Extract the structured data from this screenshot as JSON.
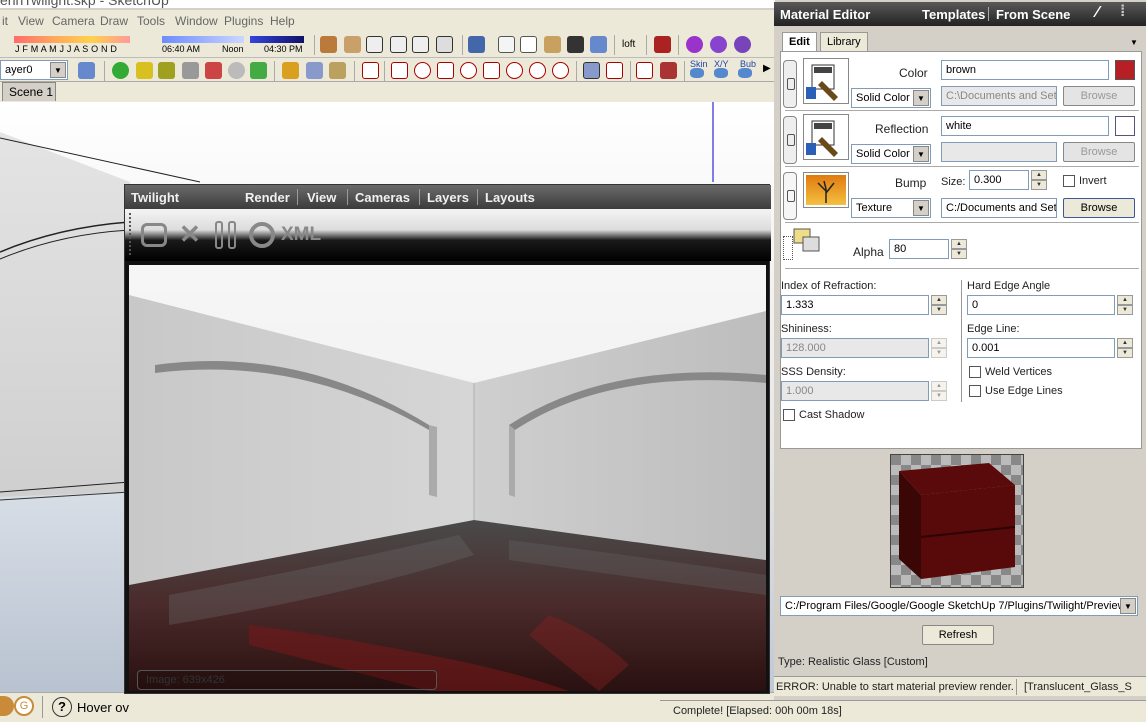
{
  "sketchup": {
    "title": "erinTwilight.skp - SketchUp",
    "menu": [
      "it",
      "View",
      "Camera",
      "Draw",
      "Tools",
      "Window",
      "Plugins",
      "Help"
    ],
    "months": "J F M A M J J A S O N D",
    "time_morning": "06:40 AM",
    "time_noon": "Noon",
    "time_evening": "04:30 PM",
    "loft_label": "loft",
    "layer_select": "ayer0",
    "toolbar_labels": {
      "skin": "Skin",
      "xy": "X/Y",
      "bub": "Bub"
    },
    "scene_tab": "Scene 1",
    "status_hover": "Hover ov",
    "complete_text": "Complete!  [Elapsed: 00h 00m 18s]"
  },
  "twilight": {
    "title": "Twilight",
    "menu": [
      "Render",
      "View",
      "Cameras",
      "Layers",
      "Layouts"
    ],
    "xml_label": "XML",
    "image_size": "Image: 639x426"
  },
  "material_editor": {
    "title": "Material Editor",
    "templates": "Templates",
    "from_scene": "From Scene",
    "tabs": [
      "Edit",
      "Library"
    ],
    "color": {
      "label": "Color",
      "type": "Solid Color",
      "value": "brown",
      "path": "C:\\Documents and Sett",
      "browse": "Browse",
      "swatch": "#b81f24"
    },
    "reflection": {
      "label": "Reflection",
      "type": "Solid Color",
      "value": "white",
      "path": "",
      "browse": "Browse",
      "swatch": "#ffffff"
    },
    "bump": {
      "label": "Bump",
      "type": "Texture",
      "size_label": "Size:",
      "size": "0.300",
      "invert": "Invert",
      "path": "C:/Documents and Sett",
      "browse": "Browse"
    },
    "alpha": {
      "label": "Alpha",
      "value": "80"
    },
    "ior": {
      "label": "Index of Refraction:",
      "value": "1.333"
    },
    "shininess": {
      "label": "Shininess:",
      "value": "128.000"
    },
    "sss": {
      "label": "SSS Density:",
      "value": "1.000"
    },
    "cast_shadow": "Cast Shadow",
    "hard_edge": {
      "label": "Hard Edge Angle",
      "value": "0"
    },
    "edge_line": {
      "label": "Edge Line:",
      "value": "0.001"
    },
    "weld_vertices": "Weld Vertices",
    "use_edge_lines": "Use Edge Lines",
    "preview_path": "C:/Program Files/Google/Google SketchUp 7/Plugins/Twilight/Preview/",
    "refresh": "Refresh",
    "type_text": "Type: Realistic Glass [Custom]",
    "error_text": "ERROR: Unable to start material preview render.",
    "material_name": "[Translucent_Glass_S"
  }
}
